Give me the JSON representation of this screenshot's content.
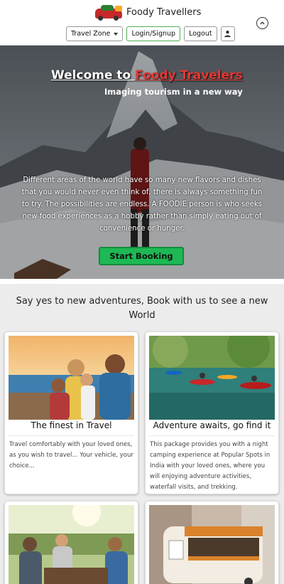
{
  "header": {
    "brand_name": "Foody Travellers",
    "nav": {
      "travel_zone": "Travel Zone",
      "login": "Login/Signup",
      "logout": "Logout"
    }
  },
  "hero": {
    "title_prefix": "Welcome to ",
    "title_accent": "Foody Travelers",
    "subtitle": "Imaging tourism in a new way",
    "paragraph": "Different areas of the world have so many new flavors and dishes that you would never even think of, there is always something fun to try. The possibilities are endless. A FOODIE person is who seeks new food experiences as a hobby rather than simply eating out of convenience or hunger.",
    "cta": "Start Booking"
  },
  "section": {
    "title": "Say yes to new adventures, Book with us to see a new World",
    "cards": [
      {
        "title": "The finest in Travel",
        "text": "Travel comfortably with your loved ones, as you wish to travel... Your vehicle, your choice..."
      },
      {
        "title": "Adventure awaits, go find it",
        "text": "This package provides you with a night camping experience at Popular Spots in India with your loved ones, where you will enjoying adventure activities, waterfall visits, and trekking."
      },
      {
        "title": "",
        "text": ""
      },
      {
        "title": "",
        "text": ""
      }
    ]
  },
  "colors": {
    "accent_red": "#e53935",
    "cta_green": "#1db954",
    "login_border": "#4caf50"
  }
}
